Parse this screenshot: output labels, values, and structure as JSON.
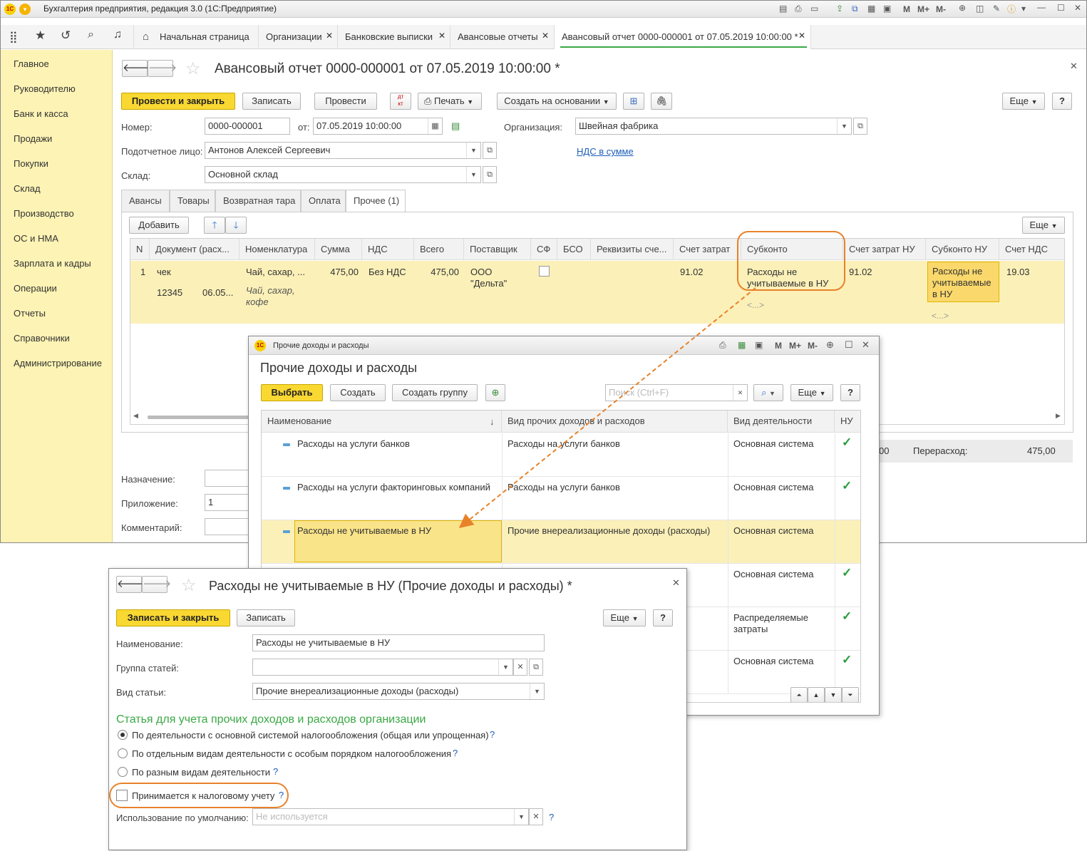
{
  "app": {
    "title": "Бухгалтерия предприятия, редакция 3.0  (1С:Предприятие)",
    "logo": "1С",
    "tb_m": "M",
    "tb_mplus": "M+",
    "tb_mminus": "M-"
  },
  "nav": {
    "home": "Начальная страница",
    "tabs": [
      "Организации",
      "Банковские выписки",
      "Авансовые отчеты",
      "Авансовый отчет 0000-000001 от 07.05.2019 10:00:00 *"
    ]
  },
  "sidebar": [
    "Главное",
    "Руководителю",
    "Банк и касса",
    "Продажи",
    "Покупки",
    "Склад",
    "Производство",
    "ОС и НМА",
    "Зарплата и кадры",
    "Операции",
    "Отчеты",
    "Справочники",
    "Администрирование"
  ],
  "doc": {
    "title": "Авансовый отчет 0000-000001 от 07.05.2019 10:00:00 *",
    "btn_post_close": "Провести и закрыть",
    "btn_save": "Записать",
    "btn_post": "Провести",
    "btn_print": "Печать",
    "btn_create_based": "Создать на основании",
    "btn_more": "Еще",
    "btn_help": "?",
    "dtkt_top": "дт",
    "dtkt_bottom": "кт",
    "number_label": "Номер:",
    "number": "0000-000001",
    "from_label": "от:",
    "date": "07.05.2019 10:00:00",
    "org_label": "Организация:",
    "org": "Швейная фабрика",
    "person_label": "Подотчетное лицо:",
    "person": "Антонов Алексей Сергеевич",
    "vat_link": "НДС в сумме",
    "warehouse_label": "Склад:",
    "warehouse": "Основной склад",
    "tabs": [
      "Авансы",
      "Товары",
      "Возвратная тара",
      "Оплата",
      "Прочее (1)"
    ],
    "btn_add": "Добавить",
    "columns": [
      "N",
      "Документ (расх...",
      "Номенклатура",
      "Сумма",
      "НДС",
      "Всего",
      "Поставщик",
      "СФ",
      "БСО",
      "Реквизиты сче...",
      "Счет затрат",
      "Субконто",
      "Счет затрат НУ",
      "Субконто НУ",
      "Счет НДС"
    ],
    "row": {
      "n": "1",
      "doc": "чек",
      "doc_num": "12345",
      "doc_date": "06.05...",
      "item": "Чай, сахар, ...",
      "item2": "Чай, сахар, кофе",
      "sum": "475,00",
      "vat": "Без НДС",
      "total": "475,00",
      "supplier": "ООО \"Дельта\"",
      "account": "91.02",
      "subconto": "Расходы не учитываемые в НУ",
      "subconto_more": "<...>",
      "account_nu": "91.02",
      "subconto_nu": "Расходы не учитываемые в НУ",
      "subconto_nu_more": "<...>",
      "vat_account": "19.03"
    },
    "total_tail": "00",
    "overspend_label": "Перерасход:",
    "overspend": "475,00",
    "purpose_label": "Назначение:",
    "attach_label": "Приложение:",
    "attach": "1",
    "comment_label": "Комментарий:"
  },
  "catalog": {
    "window_title": "Прочие доходы и расходы",
    "heading": "Прочие доходы и расходы",
    "btn_select": "Выбрать",
    "btn_create": "Создать",
    "btn_create_group": "Создать группу",
    "search_placeholder": "Поиск (Ctrl+F)",
    "btn_more": "Еще",
    "btn_help": "?",
    "columns": [
      "Наименование",
      "Вид прочих доходов и расходов",
      "Вид деятельности",
      "НУ"
    ],
    "rows": [
      {
        "name": "Расходы на услуги банков",
        "kind": "Расходы на услуги банков",
        "activity": "Основная система",
        "nu": "✓"
      },
      {
        "name": "Расходы на услуги факторинговых компаний",
        "kind": "Расходы на услуги банков",
        "activity": "Основная система",
        "nu": "✓"
      },
      {
        "name": "Расходы не учитываемые в НУ",
        "kind": "Прочие внереализационные доходы (расходы)",
        "activity": "Основная система",
        "nu": ""
      },
      {
        "name": "",
        "kind": "",
        "activity": "Основная система",
        "nu": "✓"
      },
      {
        "name": "",
        "kind": "",
        "activity": "Распределяемые затраты",
        "nu": "✓"
      },
      {
        "name": "",
        "kind": "",
        "activity": "Основная система",
        "nu": "✓"
      }
    ]
  },
  "item": {
    "title": "Расходы не учитываемые в НУ (Прочие доходы и расходы) *",
    "btn_save_close": "Записать и закрыть",
    "btn_save": "Записать",
    "btn_more": "Еще",
    "btn_help": "?",
    "name_label": "Наименование:",
    "name": "Расходы не учитываемые в НУ",
    "group_label": "Группа статей:",
    "type_label": "Вид статьи:",
    "type": "Прочие внереализационные доходы (расходы)",
    "section_title": "Статья для учета прочих доходов и расходов организации",
    "radio1": "По деятельности с основной системой налогообложения (общая или упрощенная)",
    "radio2": "По отдельным видам деятельности с особым порядком налогообложения",
    "radio3": "По разным видам деятельности",
    "checkbox": "Принимается к налоговому учету",
    "default_label": "Использование по умолчанию:",
    "default_placeholder": "Не используется",
    "q": "?"
  },
  "colors": {
    "accent": "#fad832",
    "highlight": "#fbf0b8",
    "orange": "#e8822a",
    "sidebar": "#fdf3b4",
    "green": "#2a9d3a"
  }
}
